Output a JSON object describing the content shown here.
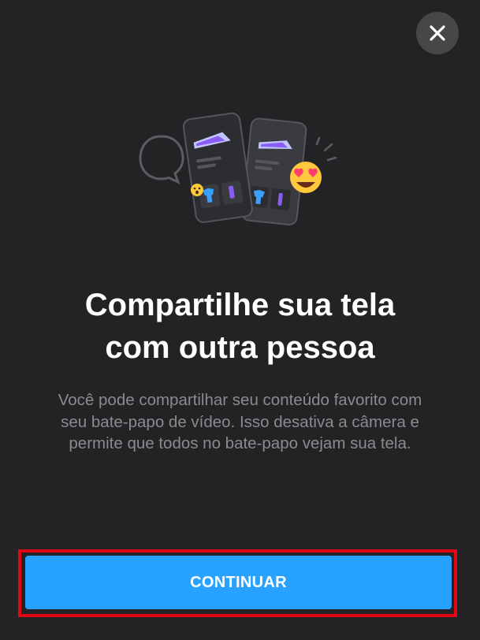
{
  "dialog": {
    "close_icon": "close-icon",
    "title_line1": "Compartilhe sua tela",
    "title_line2": "com outra pessoa",
    "description": "Você pode compartilhar seu conteúdo favorito com seu bate-papo de vídeo. Isso desativa a câmera e permite que todos no bate-papo vejam sua tela.",
    "continue_label": "CONTINUAR"
  },
  "colors": {
    "background": "#232325",
    "accent": "#27a3ff",
    "highlight_border": "#e30613",
    "close_button_bg": "#47474a",
    "description_text": "#8a8b8f"
  }
}
